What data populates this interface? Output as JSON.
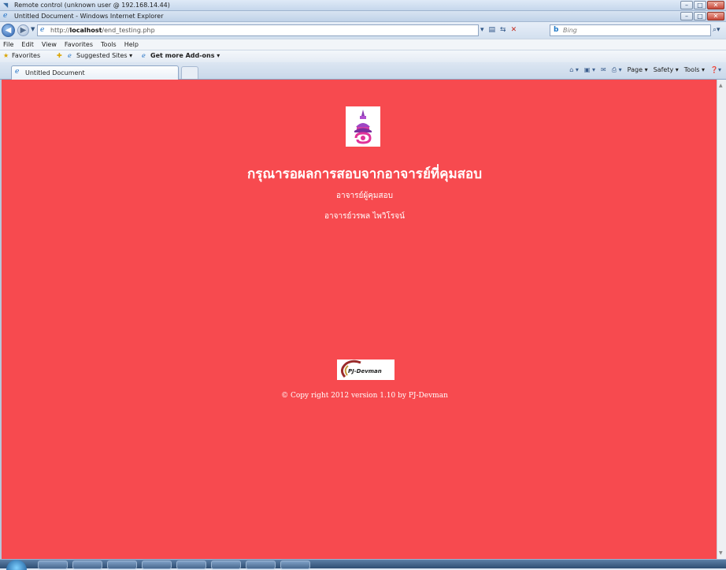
{
  "outer_window": {
    "title": "Remote control (unknown user @ 192.168.14.44)",
    "buttons": [
      "–",
      "□",
      "✕"
    ]
  },
  "ie_window": {
    "title": "Untitled Document - Windows Internet Explorer",
    "buttons": [
      "–",
      "□",
      "✕"
    ]
  },
  "address_bar": {
    "url_prefix": "http://",
    "url_host": "localhost",
    "url_path": "/end_testing.php"
  },
  "search": {
    "placeholder": "Bing"
  },
  "menu": [
    "File",
    "Edit",
    "View",
    "Favorites",
    "Tools",
    "Help"
  ],
  "favorites_bar": {
    "favorites_label": "Favorites",
    "suggested_sites_label": "Suggested Sites ▾",
    "get_addons_label": "Get more Add-ons ▾"
  },
  "tab": {
    "active_label": "Untitled Document"
  },
  "command_bar": {
    "page_label": "Page ▾",
    "safety_label": "Safety ▾",
    "tools_label": "Tools ▾"
  },
  "page": {
    "title": "กรุณารอผลการสอบจากอาจารย์ที่คุมสอบ",
    "proctor_heading": "อาจารย์ผู้คุมสอบ",
    "proctor_name": "อาจารย์วรพล ไพวิโรจน์",
    "footer_logo_text": "PJ-Devman",
    "copyright": "© Copy right 2012 version 1.10 by PJ-Devman"
  },
  "colors": {
    "page_background": "#f74a4f",
    "page_text": "#ffffff"
  }
}
